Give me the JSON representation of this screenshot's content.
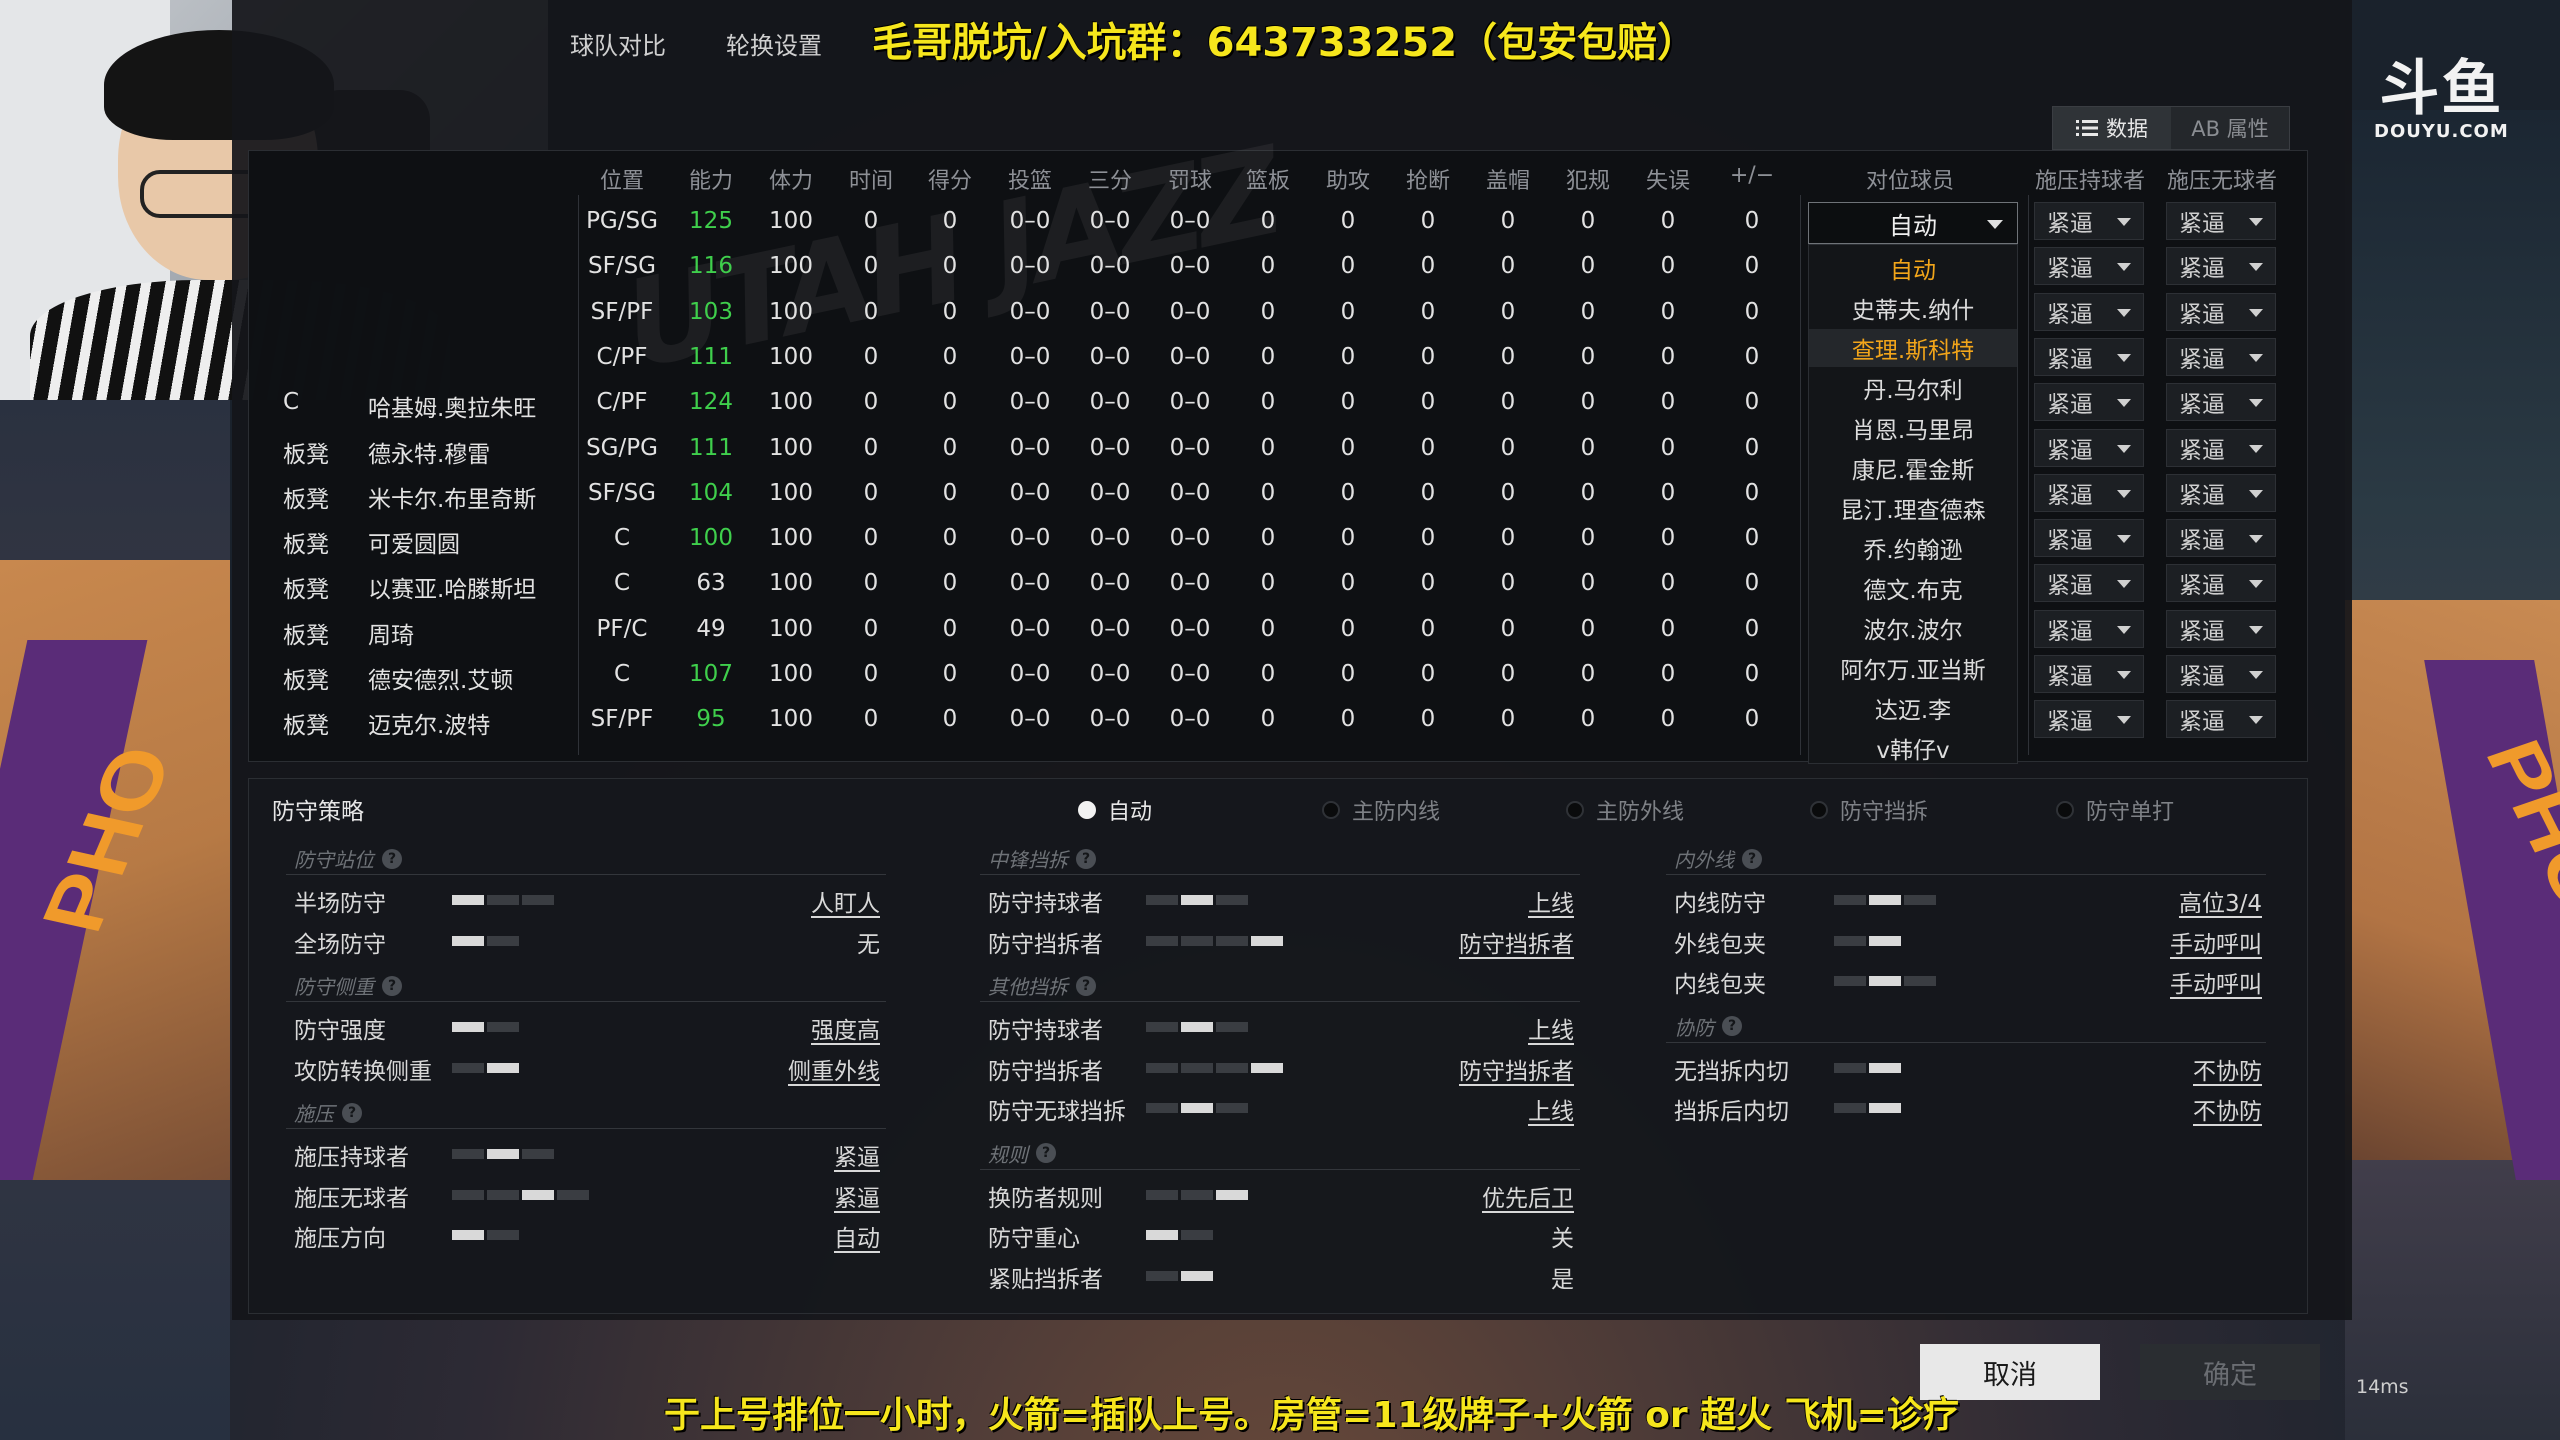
{
  "tabs": [
    "球队对比",
    "轮换设置"
  ],
  "promo_text": "毛哥脱坑/入坑群：643733252（包安包赔）",
  "view_toggle": {
    "data_label": "数据",
    "attr_label": "AB 属性"
  },
  "watermark": {
    "logo": "斗鱼",
    "domain": "DOUYU.COM"
  },
  "stats": {
    "headers": [
      "位置",
      "能力",
      "体力",
      "时间",
      "得分",
      "投篮",
      "三分",
      "罚球",
      "篮板",
      "助攻",
      "抢断",
      "盖帽",
      "犯规",
      "失误",
      "+/−",
      "对位球员",
      "施压持球者",
      "施压无球者"
    ],
    "rows": [
      {
        "role": "",
        "name": "",
        "pos": "PG/SG",
        "ovr": "125",
        "ovr_green": true,
        "sta": "100",
        "min": "0",
        "pts": "0",
        "fg": "0–0",
        "tp": "0–0",
        "ft": "0–0",
        "reb": "0",
        "ast": "0",
        "stl": "0",
        "blk": "0",
        "pf": "0",
        "to": "0",
        "pm": "0",
        "p1": "紧逼",
        "p2": "紧逼"
      },
      {
        "role": "",
        "name": "",
        "pos": "SF/SG",
        "ovr": "116",
        "ovr_green": true,
        "sta": "100",
        "min": "0",
        "pts": "0",
        "fg": "0–0",
        "tp": "0–0",
        "ft": "0–0",
        "reb": "0",
        "ast": "0",
        "stl": "0",
        "blk": "0",
        "pf": "0",
        "to": "0",
        "pm": "0",
        "p1": "紧逼",
        "p2": "紧逼"
      },
      {
        "role": "",
        "name": "",
        "pos": "SF/PF",
        "ovr": "103",
        "ovr_green": true,
        "sta": "100",
        "min": "0",
        "pts": "0",
        "fg": "0–0",
        "tp": "0–0",
        "ft": "0–0",
        "reb": "0",
        "ast": "0",
        "stl": "0",
        "blk": "0",
        "pf": "0",
        "to": "0",
        "pm": "0",
        "p1": "紧逼",
        "p2": "紧逼"
      },
      {
        "role": "",
        "name": "",
        "pos": "C/PF",
        "ovr": "111",
        "ovr_green": true,
        "sta": "100",
        "min": "0",
        "pts": "0",
        "fg": "0–0",
        "tp": "0–0",
        "ft": "0–0",
        "reb": "0",
        "ast": "0",
        "stl": "0",
        "blk": "0",
        "pf": "0",
        "to": "0",
        "pm": "0",
        "p1": "紧逼",
        "p2": "紧逼"
      },
      {
        "role": "C",
        "name": "哈基姆.奥拉朱旺",
        "pos": "C/PF",
        "ovr": "124",
        "ovr_green": true,
        "sta": "100",
        "min": "0",
        "pts": "0",
        "fg": "0–0",
        "tp": "0–0",
        "ft": "0–0",
        "reb": "0",
        "ast": "0",
        "stl": "0",
        "blk": "0",
        "pf": "0",
        "to": "0",
        "pm": "0",
        "p1": "紧逼",
        "p2": "紧逼"
      },
      {
        "role": "板凳",
        "name": "德永特.穆雷",
        "pos": "SG/PG",
        "ovr": "111",
        "ovr_green": true,
        "sta": "100",
        "min": "0",
        "pts": "0",
        "fg": "0–0",
        "tp": "0–0",
        "ft": "0–0",
        "reb": "0",
        "ast": "0",
        "stl": "0",
        "blk": "0",
        "pf": "0",
        "to": "0",
        "pm": "0",
        "p1": "紧逼",
        "p2": "紧逼"
      },
      {
        "role": "板凳",
        "name": "米卡尔.布里奇斯",
        "pos": "SF/SG",
        "ovr": "104",
        "ovr_green": true,
        "sta": "100",
        "min": "0",
        "pts": "0",
        "fg": "0–0",
        "tp": "0–0",
        "ft": "0–0",
        "reb": "0",
        "ast": "0",
        "stl": "0",
        "blk": "0",
        "pf": "0",
        "to": "0",
        "pm": "0",
        "p1": "紧逼",
        "p2": "紧逼"
      },
      {
        "role": "板凳",
        "name": "可爱圆圆",
        "pos": "C",
        "ovr": "100",
        "ovr_green": true,
        "sta": "100",
        "min": "0",
        "pts": "0",
        "fg": "0–0",
        "tp": "0–0",
        "ft": "0–0",
        "reb": "0",
        "ast": "0",
        "stl": "0",
        "blk": "0",
        "pf": "0",
        "to": "0",
        "pm": "0",
        "p1": "紧逼",
        "p2": "紧逼"
      },
      {
        "role": "板凳",
        "name": "以赛亚.哈滕斯坦",
        "pos": "C",
        "ovr": "63",
        "ovr_green": false,
        "sta": "100",
        "min": "0",
        "pts": "0",
        "fg": "0–0",
        "tp": "0–0",
        "ft": "0–0",
        "reb": "0",
        "ast": "0",
        "stl": "0",
        "blk": "0",
        "pf": "0",
        "to": "0",
        "pm": "0",
        "p1": "紧逼",
        "p2": "紧逼"
      },
      {
        "role": "板凳",
        "name": "周琦",
        "pos": "PF/C",
        "ovr": "49",
        "ovr_green": false,
        "sta": "100",
        "min": "0",
        "pts": "0",
        "fg": "0–0",
        "tp": "0–0",
        "ft": "0–0",
        "reb": "0",
        "ast": "0",
        "stl": "0",
        "blk": "0",
        "pf": "0",
        "to": "0",
        "pm": "0",
        "p1": "紧逼",
        "p2": "紧逼"
      },
      {
        "role": "板凳",
        "name": "德安德烈.艾顿",
        "pos": "C",
        "ovr": "107",
        "ovr_green": true,
        "sta": "100",
        "min": "0",
        "pts": "0",
        "fg": "0–0",
        "tp": "0–0",
        "ft": "0–0",
        "reb": "0",
        "ast": "0",
        "stl": "0",
        "blk": "0",
        "pf": "0",
        "to": "0",
        "pm": "0",
        "p1": "紧逼",
        "p2": "紧逼"
      },
      {
        "role": "板凳",
        "name": "迈克尔.波特",
        "pos": "SF/PF",
        "ovr": "95",
        "ovr_green": true,
        "sta": "100",
        "min": "0",
        "pts": "0",
        "fg": "0–0",
        "tp": "0–0",
        "ft": "0–0",
        "reb": "0",
        "ast": "0",
        "stl": "0",
        "blk": "0",
        "pf": "0",
        "to": "0",
        "pm": "0",
        "p1": "紧逼",
        "p2": "紧逼"
      }
    ]
  },
  "matchup": {
    "selected": "自动",
    "options": [
      "自动",
      "史蒂夫.纳什",
      "查理.斯科特",
      "丹.马尔利",
      "肖恩.马里昂",
      "康尼.霍金斯",
      "昆汀.理查德森",
      "乔.约翰逊",
      "德文.布克",
      "波尔.波尔",
      "阿尔万.亚当斯",
      "达迈.李",
      "v韩仔v"
    ],
    "current_index": 0,
    "hover_index": 2
  },
  "defense": {
    "title": "防守策略",
    "modes": [
      "自动",
      "主防内线",
      "主防外线",
      "防守挡拆",
      "防守单打"
    ],
    "active_mode": 0,
    "columns": [
      {
        "sections": [
          {
            "label": "防守站位",
            "items": [
              {
                "label": "半场防守",
                "value": "人盯人",
                "level": 0.2,
                "segs": 3,
                "underline": true
              },
              {
                "label": "全场防守",
                "value": "无",
                "level": 0.0,
                "segs": 2,
                "underline": false
              }
            ]
          },
          {
            "label": "防守侧重",
            "items": [
              {
                "label": "防守强度",
                "value": "强度高",
                "level": 0.0,
                "segs": 2,
                "underline": true
              },
              {
                "label": "攻防转换侧重",
                "value": "侧重外线",
                "level": 1.0,
                "segs": 2,
                "underline": true
              }
            ]
          },
          {
            "label": "施压",
            "items": [
              {
                "label": "施压持球者",
                "value": "紧逼",
                "level": 0.67,
                "segs": 3,
                "underline": true
              },
              {
                "label": "施压无球者",
                "value": "紧逼",
                "level": 0.75,
                "segs": 4,
                "underline": true
              },
              {
                "label": "施压方向",
                "value": "自动",
                "level": 0.0,
                "segs": 2,
                "underline": true
              }
            ]
          }
        ]
      },
      {
        "sections": [
          {
            "label": "中锋挡拆",
            "items": [
              {
                "label": "防守持球者",
                "value": "上线",
                "level": 0.33,
                "segs": 3,
                "underline": true
              },
              {
                "label": "防守挡拆者",
                "value": "防守挡拆者",
                "level": 1.0,
                "segs": 4,
                "underline": true
              }
            ]
          },
          {
            "label": "其他挡拆",
            "items": [
              {
                "label": "防守持球者",
                "value": "上线",
                "level": 0.33,
                "segs": 3,
                "underline": true
              },
              {
                "label": "防守挡拆者",
                "value": "防守挡拆者",
                "level": 1.0,
                "segs": 4,
                "underline": true
              },
              {
                "label": "防守无球挡拆",
                "value": "上线",
                "level": 0.5,
                "segs": 3,
                "underline": true
              }
            ]
          },
          {
            "label": "规则",
            "items": [
              {
                "label": "换防者规则",
                "value": "优先后卫",
                "level": 1.0,
                "segs": 3,
                "underline": true
              },
              {
                "label": "防守重心",
                "value": "关",
                "level": 0.0,
                "segs": 2,
                "underline": false
              },
              {
                "label": "紧贴挡拆者",
                "value": "是",
                "level": 0.5,
                "segs": 2,
                "underline": false
              }
            ]
          }
        ]
      },
      {
        "sections": [
          {
            "label": "内外线",
            "items": [
              {
                "label": "内线防守",
                "value": "高位3/4",
                "level": 0.67,
                "segs": 3,
                "underline": true
              },
              {
                "label": "外线包夹",
                "value": "手动呼叫",
                "level": 1.0,
                "segs": 2,
                "underline": true
              },
              {
                "label": "内线包夹",
                "value": "手动呼叫",
                "level": 0.33,
                "segs": 3,
                "underline": true
              }
            ]
          },
          {
            "label": "协防",
            "items": [
              {
                "label": "无挡拆内切",
                "value": "不协防",
                "level": 1.0,
                "segs": 2,
                "underline": true
              },
              {
                "label": "挡拆后内切",
                "value": "不协防",
                "level": 1.0,
                "segs": 2,
                "underline": true
              }
            ]
          }
        ]
      }
    ]
  },
  "buttons": {
    "cancel": "取消",
    "confirm": "确定"
  },
  "ticker": "于上号排位一小时，火箭=插队上号。房管=11级牌子+火箭 or 超火 飞机=诊疗",
  "latency": "14ms",
  "court_text": "PHO",
  "help_glyph": "?"
}
